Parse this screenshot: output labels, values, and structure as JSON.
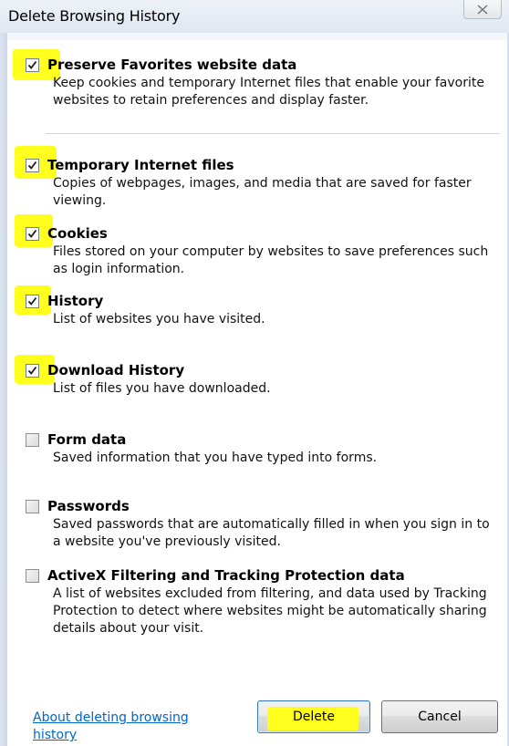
{
  "window": {
    "title": "Delete Browsing History",
    "close_glyph": "✕"
  },
  "options": [
    {
      "title": "Preserve Favorites website data",
      "description": "Keep cookies and temporary Internet files that enable your favorite websites to retain preferences and display faster.",
      "checked": true,
      "highlighted": true
    },
    {
      "title": "Temporary Internet files",
      "description": "Copies of webpages, images, and media that are saved for faster viewing.",
      "checked": true,
      "highlighted": true
    },
    {
      "title": "Cookies",
      "description": "Files stored on your computer by websites to save preferences such as login information.",
      "checked": true,
      "highlighted": true
    },
    {
      "title": "History",
      "description": "List of websites you have visited.",
      "checked": true,
      "highlighted": true
    },
    {
      "title": "Download History",
      "description": "List of files you have downloaded.",
      "checked": true,
      "highlighted": true
    },
    {
      "title": "Form data",
      "description": "Saved information that you have typed into forms.",
      "checked": false,
      "highlighted": false
    },
    {
      "title": "Passwords",
      "description": "Saved passwords that are automatically filled in when you sign in to a website you've previously visited.",
      "checked": false,
      "highlighted": false
    },
    {
      "title": "ActiveX Filtering and Tracking Protection data",
      "description": "A list of websites excluded from filtering, and data used by Tracking Protection to detect where websites might be automatically sharing details about your visit.",
      "checked": false,
      "highlighted": false
    }
  ],
  "footer": {
    "link_label": "About deleting browsing history",
    "delete_label": "Delete",
    "cancel_label": "Cancel"
  },
  "colors": {
    "highlight": "#ffff1e",
    "link": "#0066cc"
  }
}
